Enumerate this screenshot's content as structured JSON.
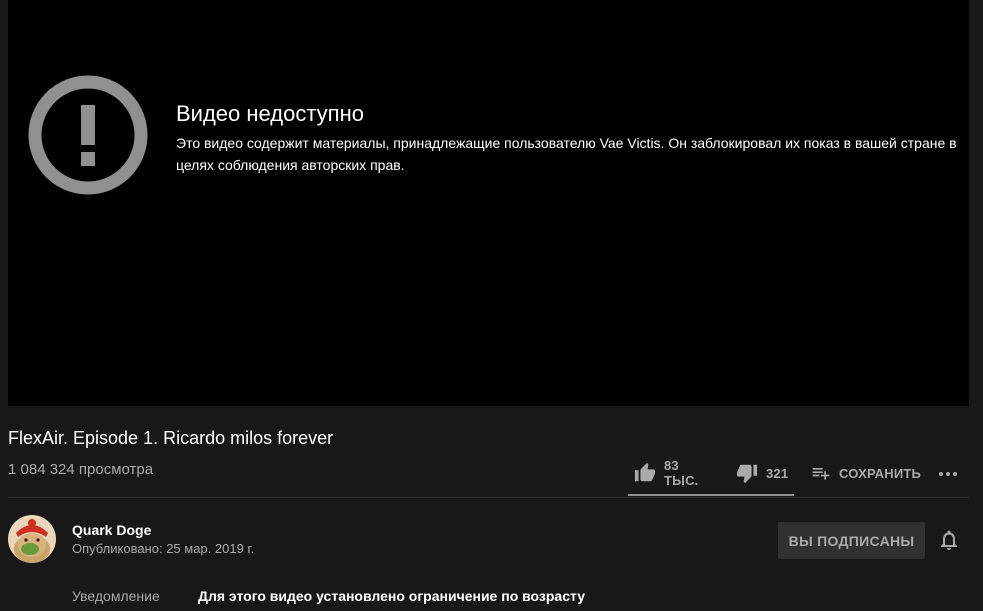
{
  "player": {
    "error_title": "Видео недоступно",
    "error_message": "Это видео содержит материалы, принадлежащие пользователю Vae Victis. Он заблокировал их показ в вашей стране в целях соблюдения авторских прав.",
    "error_icon": "exclamation-circle-icon"
  },
  "video": {
    "title": "FlexAir. Episode 1. Ricardo milos forever",
    "views": "1 084 324 просмотра"
  },
  "actions": {
    "like_count": "83 ТЫС.",
    "dislike_count": "321",
    "save_label": "СОХРАНИТЬ",
    "more_icon": "more-horizontal-icon"
  },
  "channel": {
    "name": "Quark Doge",
    "published": "Опубликовано: 25 мар. 2019 г.",
    "subscribe_label": "ВЫ ПОДПИСАНЫ",
    "bell_icon": "bell-icon"
  },
  "metadata": {
    "label": "Уведомление",
    "value": "Для этого видео установлено ограничение по возрасту"
  },
  "colors": {
    "background": "#181818",
    "player_bg": "#000000",
    "icon_grey": "#aaaaaa",
    "button_bg": "#303030"
  }
}
